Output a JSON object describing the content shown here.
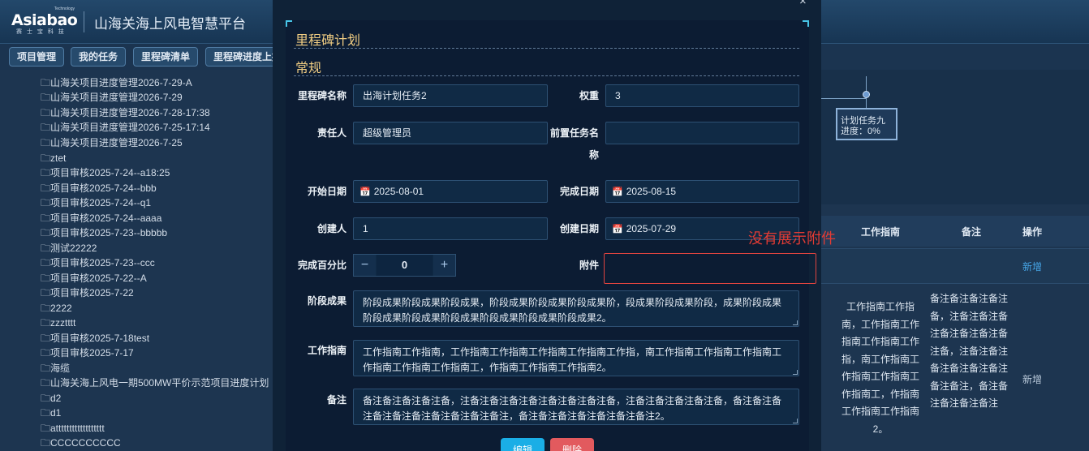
{
  "header": {
    "logo_text": "Asiabao",
    "logo_tech": "Technology",
    "logo_cn": "赛 士 宝 科 技",
    "title": "山海关海上风电智慧平台"
  },
  "tabs": [
    "项目管理",
    "我的任务",
    "里程碑清单",
    "里程碑进度上报"
  ],
  "tree": [
    "🗀山海关项目进度管理2026-7-29-A",
    "🗀山海关项目进度管理2026-7-29",
    "🗀山海关项目进度管理2026-7-28-17:38",
    "🗀山海关项目进度管理2026-7-25-17:14",
    "🗀山海关项目进度管理2026-7-25",
    "🗀ztet",
    "🗀项目审核2025-7-24--a18:25",
    "🗀项目审核2025-7-24--bbb",
    "🗀项目审核2025-7-24--q1",
    "🗀项目审核2025-7-24--aaaa",
    "🗀项目审核2025-7-23--bbbbb",
    "🗀测试22222",
    "🗀项目审核2025-7-23--ccc",
    "🗀项目审核2025-7-22--A",
    "🗀项目审核2025-7-22",
    "🗀2222",
    "🗀zzztttt",
    "🗀项目审核2025-7-18test",
    "🗀项目审核2025-7-17",
    "🗀海缆",
    "🗀山海关海上风电一期500MW平价示范项目进度计划",
    "🗀d2",
    "🗀d1",
    "🗀atttttttttttttttttt",
    "🗀CCCCCCCCCC"
  ],
  "gantt": {
    "task_name": "计划任务九",
    "task_progress": "进度：0%"
  },
  "table": {
    "headers": {
      "guide": "工作指南",
      "remark": "备注",
      "action": "操作"
    },
    "row1_action": "新增",
    "row2_guide": "工作指南工作指南，工作指南工作指南工作指南工作指，南工作指南工作指南工作指南工作指南工，作指南工作指南工作指南2。",
    "row2_remark": "备注备注备注备注备，注备注备注备注备注备注备注备注备，注备注备注备注备注备注备注备注备注，备注备注备注备注备注",
    "row2_action": "新增"
  },
  "modal": {
    "close": "×",
    "title": "里程碑计划",
    "section": "常规",
    "fields": {
      "name_label": "里程碑名称",
      "name_value": "出海计划任务2",
      "weight_label": "权重",
      "weight_value": "3",
      "owner_label": "责任人",
      "owner_value": "超级管理员",
      "pre_label_1": "前置任务名",
      "pre_label_2": "称",
      "pre_value": "",
      "start_label": "开始日期",
      "start_value": "2025-08-01",
      "end_label": "完成日期",
      "end_value": "2025-08-15",
      "creator_label": "创建人",
      "creator_value": "1",
      "created_label": "创建日期",
      "created_value": "2025-07-29",
      "percent_label": "完成百分比",
      "percent_value": "0",
      "attach_label": "附件",
      "stage_label": "阶段成果",
      "stage_value": "阶段成果阶段成果阶段成果，阶段成果阶段成果阶段成果阶，段成果阶段成果阶段，成果阶段成果阶段成果阶段成果阶段成果阶段成果阶段成果阶段成果2。",
      "guide_label": "工作指南",
      "guide_value": "工作指南工作指南，工作指南工作指南工作指南工作指南工作指，南工作指南工作指南工作指南工作指南工作指南工作指南工，作指南工作指南工作指南2。",
      "remark_label": "备注",
      "remark_value": "备注备注备注备注备，注备注备注备注备注备注备注备注备，注备注备注备注备注备，备注备注备注备注备注备注备注备注备注备注，备注备注备注备注备注备注备注2。"
    },
    "edit_button": "编辑",
    "delete_button": "删除"
  },
  "annotation": "没有展示附件",
  "colors": {
    "accent": "#f2ce83",
    "annotation": "#e23b34",
    "primary_button": "#1aaee6",
    "danger_button": "#e25a5e"
  }
}
